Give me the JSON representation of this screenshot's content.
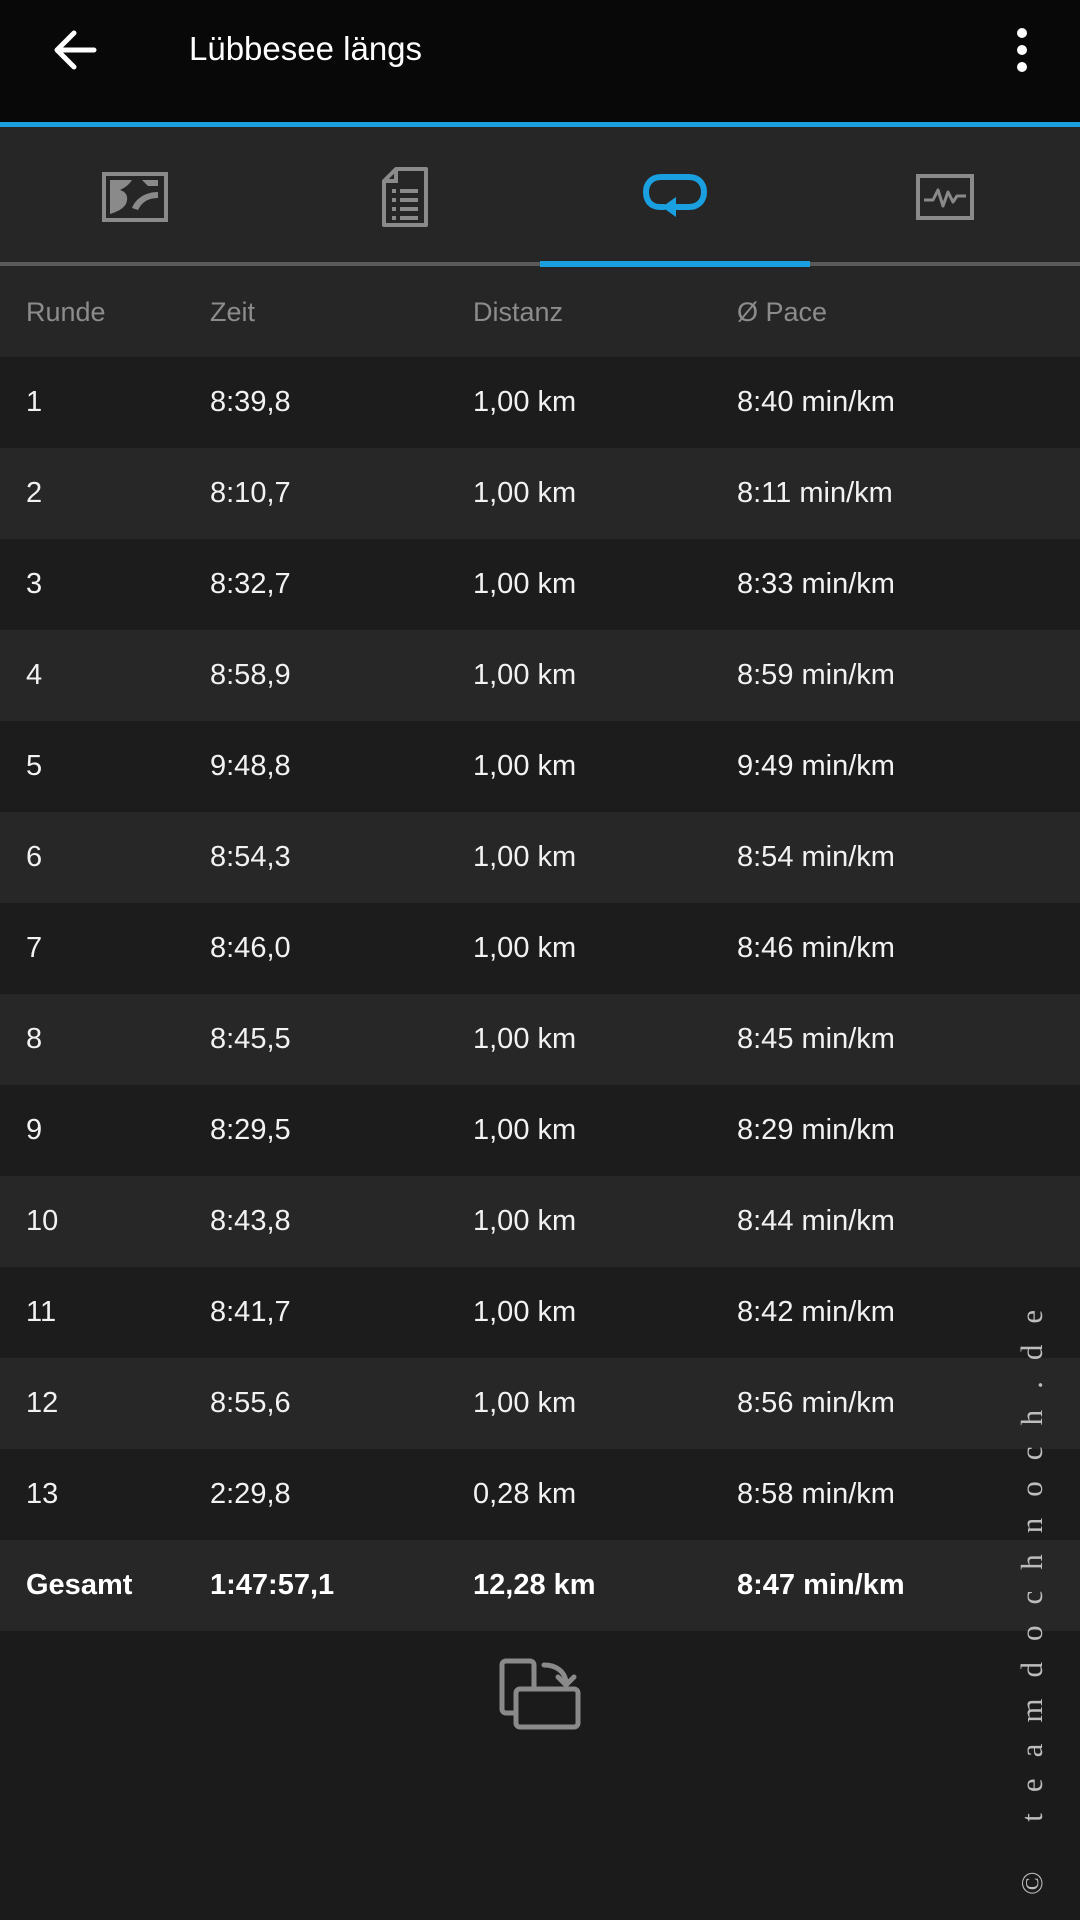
{
  "appbar": {
    "title": "Lübbesee längs",
    "back_icon": "arrow-left-icon",
    "menu_icon": "more-vertical-icon"
  },
  "tabs": [
    {
      "icon": "map-icon",
      "active": false
    },
    {
      "icon": "details-list-icon",
      "active": false
    },
    {
      "icon": "laps-loop-icon",
      "active": true
    },
    {
      "icon": "chart-icon",
      "active": false
    }
  ],
  "colors": {
    "accent": "#1aa0e0",
    "background": "#1b1b1b",
    "appbar": "#080808"
  },
  "table": {
    "headers": {
      "lap": "Runde",
      "time": "Zeit",
      "distance": "Distanz",
      "pace": "Ø Pace"
    },
    "rows": [
      {
        "lap": "1",
        "time": "8:39,8",
        "distance": "1,00 km",
        "pace": "8:40 min/km"
      },
      {
        "lap": "2",
        "time": "8:10,7",
        "distance": "1,00 km",
        "pace": "8:11 min/km"
      },
      {
        "lap": "3",
        "time": "8:32,7",
        "distance": "1,00 km",
        "pace": "8:33 min/km"
      },
      {
        "lap": "4",
        "time": "8:58,9",
        "distance": "1,00 km",
        "pace": "8:59 min/km"
      },
      {
        "lap": "5",
        "time": "9:48,8",
        "distance": "1,00 km",
        "pace": "9:49 min/km"
      },
      {
        "lap": "6",
        "time": "8:54,3",
        "distance": "1,00 km",
        "pace": "8:54 min/km"
      },
      {
        "lap": "7",
        "time": "8:46,0",
        "distance": "1,00 km",
        "pace": "8:46 min/km"
      },
      {
        "lap": "8",
        "time": "8:45,5",
        "distance": "1,00 km",
        "pace": "8:45 min/km"
      },
      {
        "lap": "9",
        "time": "8:29,5",
        "distance": "1,00 km",
        "pace": "8:29 min/km"
      },
      {
        "lap": "10",
        "time": "8:43,8",
        "distance": "1,00 km",
        "pace": "8:44 min/km"
      },
      {
        "lap": "11",
        "time": "8:41,7",
        "distance": "1,00 km",
        "pace": "8:42 min/km"
      },
      {
        "lap": "12",
        "time": "8:55,6",
        "distance": "1,00 km",
        "pace": "8:56 min/km"
      },
      {
        "lap": "13",
        "time": "2:29,8",
        "distance": "0,28 km",
        "pace": "8:58 min/km"
      }
    ],
    "total": {
      "lap": "Gesamt",
      "time": "1:47:57,1",
      "distance": "12,28 km",
      "pace": "8:47 min/km"
    }
  },
  "rotate_icon": "screen-rotate-icon",
  "watermark": "© teamdochnoch.de"
}
